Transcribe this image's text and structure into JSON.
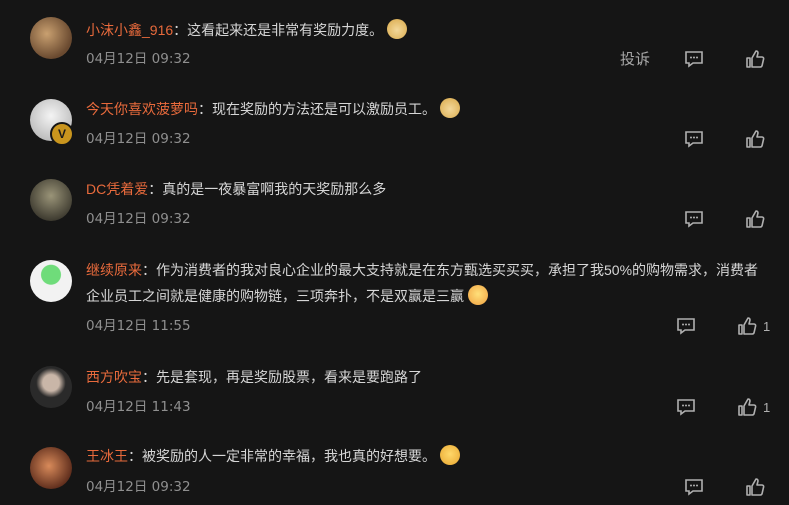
{
  "comments": [
    {
      "user": "小沫小鑫_916",
      "sep": "：",
      "text": "这看起来还是非常有奖励力度。",
      "time": "04月12日 09:32",
      "likes": "",
      "report": "投诉",
      "avatar_color": "#8a6a4a",
      "emoji": "doge-emoji"
    },
    {
      "user": "今天你喜欢菠萝吗",
      "sep": "：",
      "text": "现在奖励的方法还是可以激励员工。",
      "time": "04月12日 09:32",
      "likes": "",
      "avatar_color": "#e8e8e8",
      "emoji": "doge-emoji",
      "badge": "V"
    },
    {
      "user": "DC凭着爱",
      "sep": "：",
      "text": "真的是一夜暴富啊我的天奖励那么多",
      "time": "04月12日 09:32",
      "likes": "",
      "avatar_color": "#6d6a58"
    },
    {
      "user": "继续原来",
      "sep": "：",
      "text": "作为消费者的我对良心企业的最大支持就是在东方甄选买买买，承担了我50%的购物需求，消费者企业员工之间就是健康的购物链，三项奔扑，不是双赢是三赢",
      "time": "04月12日 11:55",
      "likes": "1",
      "avatar_color": "#f2f2f2",
      "emoji": "scream-emoji"
    },
    {
      "user": "西方吹宝",
      "sep": "：",
      "text": "先是套现，再是奖励股票，看来是要跑路了",
      "time": "04月12日 11:43",
      "likes": "1",
      "avatar_color": "#3a3a3a"
    },
    {
      "user": "王冰王",
      "sep": "：",
      "text": "被奖励的人一定非常的幸福，我也真的好想要。",
      "time": "04月12日 09:32",
      "likes": "",
      "avatar_color": "#a05a3a",
      "emoji": "shush-emoji"
    }
  ]
}
